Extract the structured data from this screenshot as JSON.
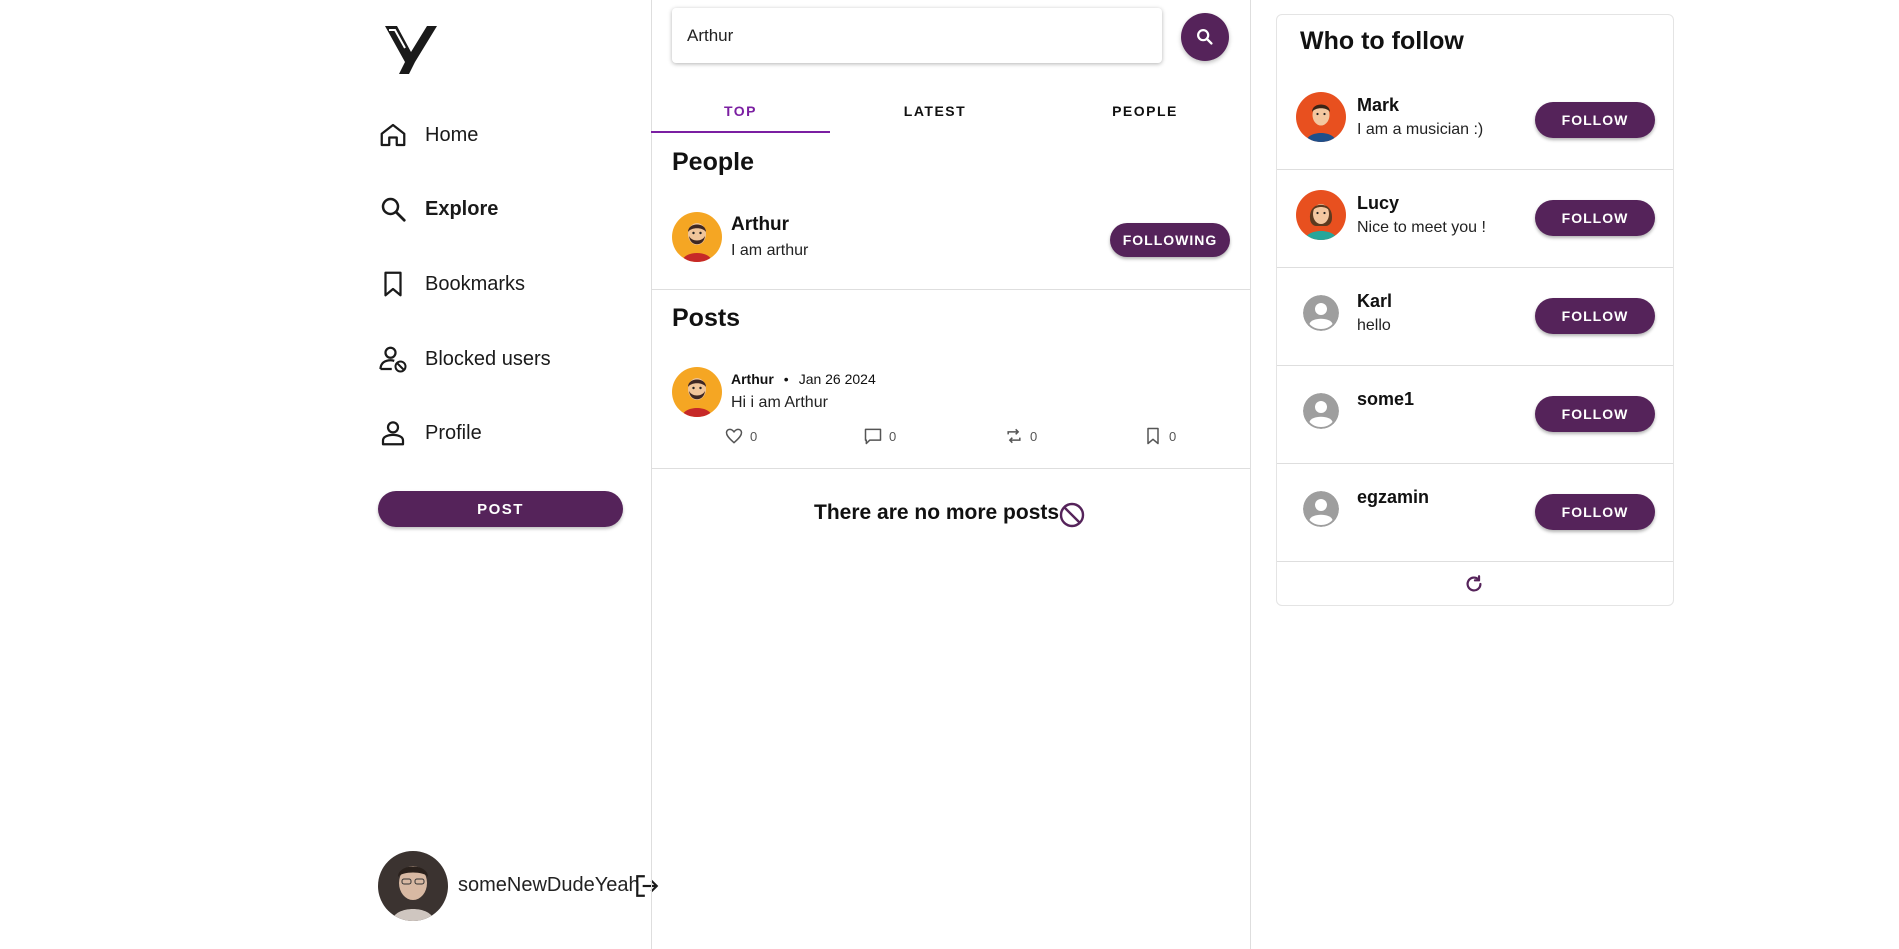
{
  "sidebar": {
    "items": [
      {
        "label": "Home",
        "icon": "home-icon"
      },
      {
        "label": "Explore",
        "icon": "search-icon",
        "active": true
      },
      {
        "label": "Bookmarks",
        "icon": "bookmark-icon"
      },
      {
        "label": "Blocked users",
        "icon": "blocked-user-icon"
      },
      {
        "label": "Profile",
        "icon": "person-icon"
      }
    ],
    "post_label": "POST",
    "current_user": "someNewDudeYeah"
  },
  "search": {
    "value": "Arthur"
  },
  "tabs": [
    {
      "label": "TOP",
      "active": true
    },
    {
      "label": "LATEST"
    },
    {
      "label": "PEOPLE"
    }
  ],
  "people_section": {
    "title": "People",
    "person": {
      "name": "Arthur",
      "bio": "I am arthur",
      "button": "FOLLOWING"
    }
  },
  "posts_section": {
    "title": "Posts",
    "post": {
      "author": "Arthur",
      "separator": "•",
      "date": "Jan 26 2024",
      "text": "Hi i am Arthur",
      "likes": "0",
      "comments": "0",
      "reposts": "0",
      "bookmarks": "0"
    },
    "end_message": "There are no more posts"
  },
  "who_to_follow": {
    "title": "Who to follow",
    "users": [
      {
        "name": "Mark",
        "bio": "I am a musician :)",
        "button": "FOLLOW"
      },
      {
        "name": "Lucy",
        "bio": "Nice to meet you !",
        "button": "FOLLOW"
      },
      {
        "name": "Karl",
        "bio": "hello",
        "button": "FOLLOW"
      },
      {
        "name": "some1",
        "bio": "",
        "button": "FOLLOW"
      },
      {
        "name": "egzamin",
        "bio": "",
        "button": "FOLLOW"
      }
    ]
  },
  "colors": {
    "brand": "#55235a",
    "tab_active": "#7b1fa2",
    "divider": "#dedede"
  }
}
